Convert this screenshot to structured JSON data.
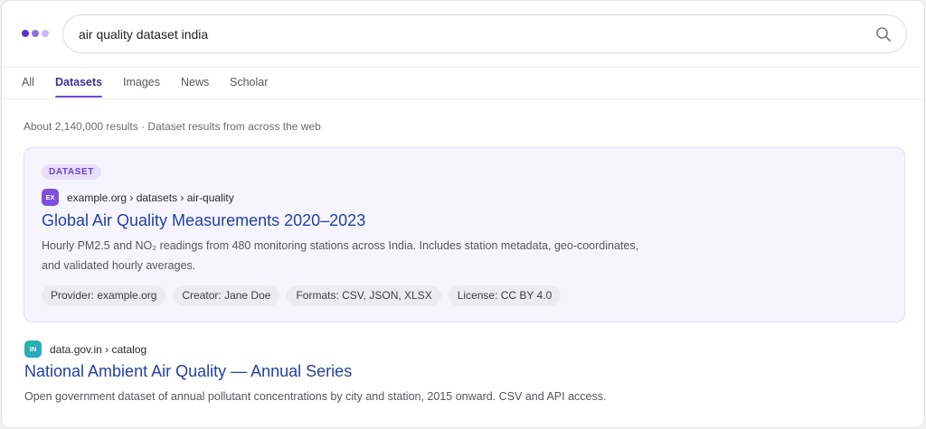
{
  "search": {
    "query": "air quality dataset india"
  },
  "tabs": [
    {
      "label": "All",
      "active": false
    },
    {
      "label": "Datasets",
      "active": true
    },
    {
      "label": "Images",
      "active": false
    },
    {
      "label": "News",
      "active": false
    },
    {
      "label": "Scholar",
      "active": false
    }
  ],
  "results_meta": "About 2,140,000 results · Dataset results from across the web",
  "featured": {
    "badge": "DATASET",
    "favicon_text": "EX",
    "breadcrumb": "example.org › datasets › air-quality",
    "title": "Global Air Quality Measurements 2020–2023",
    "snippet_line1": "Hourly PM2.5 and NO₂ readings from 480 monitoring stations across India. Includes station metadata, geo-coordinates,",
    "snippet_line2": "and validated hourly averages.",
    "chips": [
      "Provider: example.org",
      "Creator: Jane Doe",
      "Formats: CSV, JSON, XLSX",
      "License: CC BY 4.0"
    ]
  },
  "second": {
    "favicon_text": "IN",
    "breadcrumb": "data.gov.in › catalog",
    "title": "National Ambient Air Quality — Annual Series",
    "snippet": "Open government dataset of annual pollutant concentrations by city and station, 2015 onward. CSV and API access."
  },
  "icons": {
    "logo": "logo-dots",
    "search": "search-icon"
  },
  "colors": {
    "accent": "#6d4bd8",
    "link": "#233fa6",
    "featured_bg": "#f6f5fd",
    "favicon_ex": "#7c4fe0",
    "favicon_in": "#2bb3a3"
  }
}
